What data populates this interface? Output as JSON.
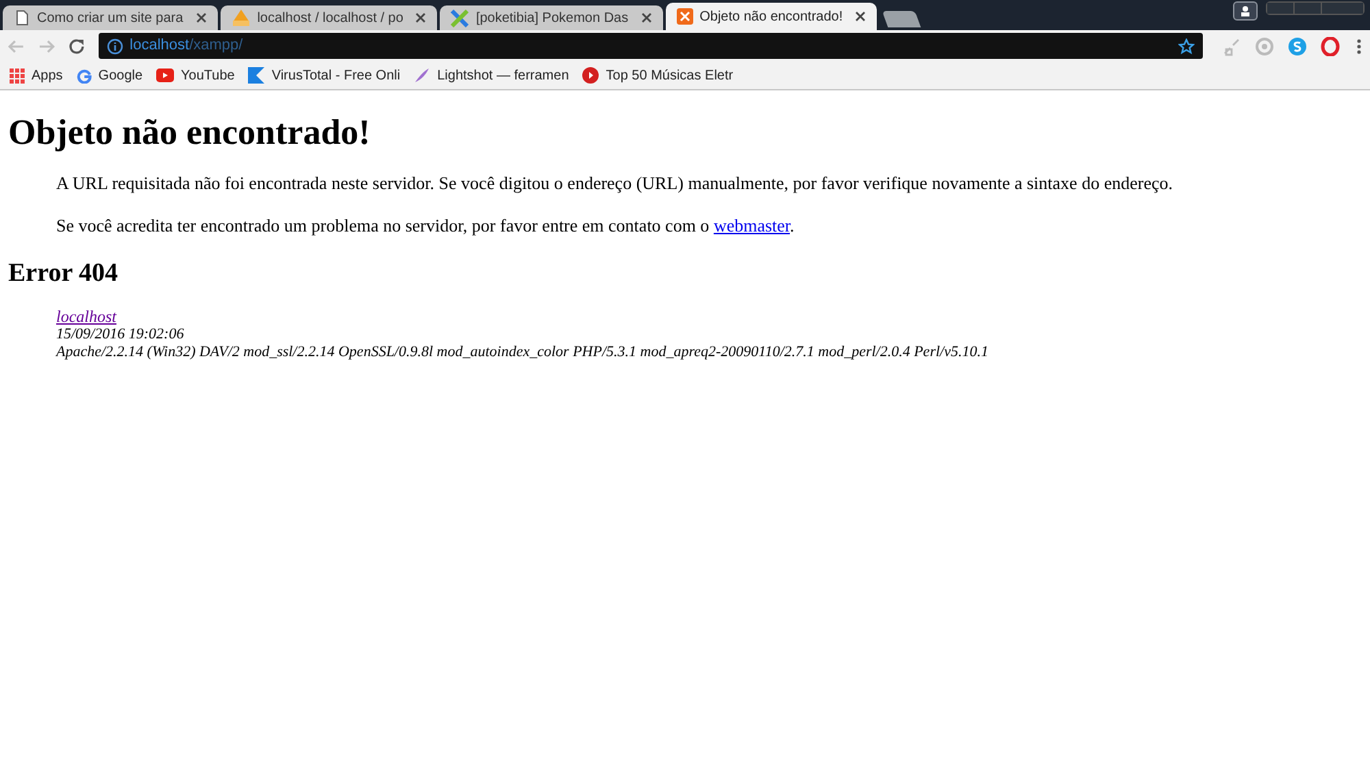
{
  "tabs": [
    {
      "title": "Como criar um site para",
      "selected": false
    },
    {
      "title": "localhost / localhost / po",
      "selected": false
    },
    {
      "title": "[poketibia] Pokemon Das",
      "selected": false
    },
    {
      "title": "Objeto não encontrado!",
      "selected": true
    }
  ],
  "address_bar": {
    "host": "localhost",
    "path": "/xampp/"
  },
  "bookmarks": [
    {
      "label": "Apps"
    },
    {
      "label": "Google"
    },
    {
      "label": "YouTube"
    },
    {
      "label": "VirusTotal - Free Onli"
    },
    {
      "label": "Lightshot — ferramen"
    },
    {
      "label": "Top 50 Músicas Eletr"
    }
  ],
  "page": {
    "heading": "Objeto não encontrado!",
    "paragraphs": [
      "A URL requisitada não foi encontrada neste servidor. Se você digitou o endereço (URL) manualmente, por favor verifique novamente a sintaxe do endereço.",
      "Se você acredita ter encontrado um problema no servidor, por favor entre em contato com o "
    ],
    "link": "webmaster",
    "after_link": ".",
    "subheading": "Error 404",
    "address": {
      "link": "localhost",
      "date": "15/09/2016 19:02:06",
      "server": "Apache/2.2.14 (Win32) DAV/2 mod_ssl/2.2.14 OpenSSL/0.9.8l mod_autoindex_color PHP/5.3.1 mod_apreq2-20090110/2.7.1 mod_perl/2.0.4 Perl/v5.10.1"
    }
  }
}
